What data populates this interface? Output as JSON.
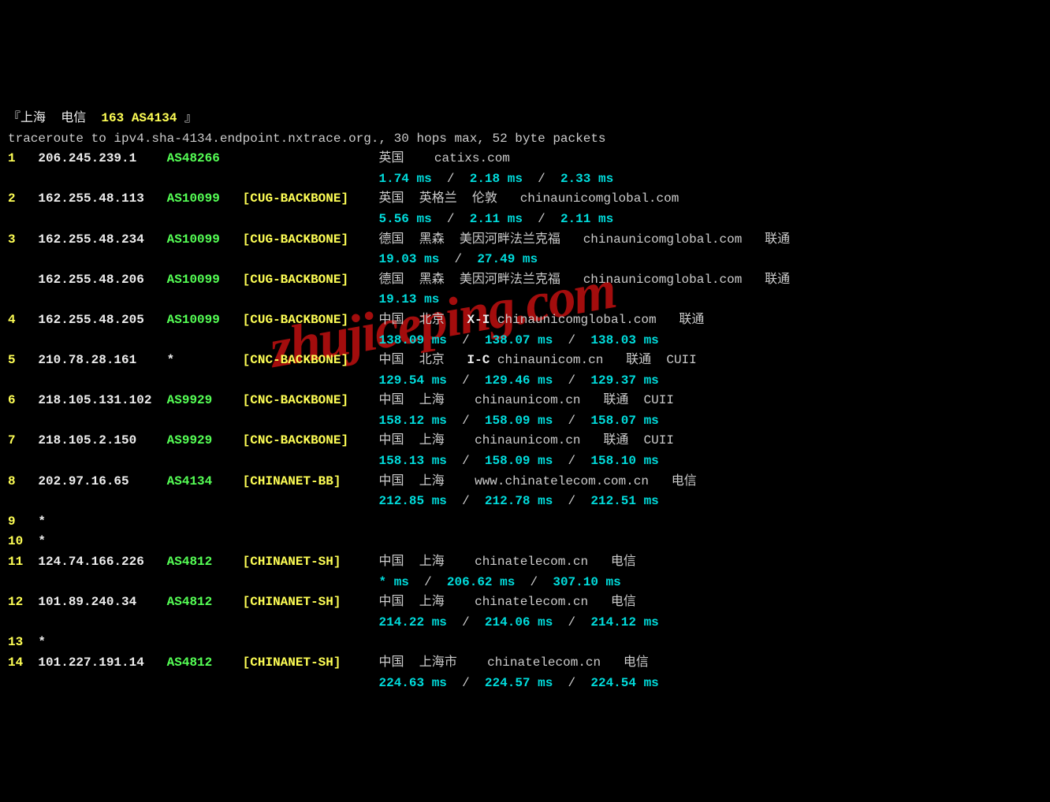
{
  "header": {
    "title": "『上海  电信  163 AS4134 』",
    "title_prefix": "『上海  电信  ",
    "title_yellow": "163 AS4134 ",
    "title_suffix": "』",
    "command": "traceroute to ipv4.sha-4134.endpoint.nxtrace.org., 30 hops max, 52 byte packets"
  },
  "watermark": "zhujiceping.com",
  "hops": [
    {
      "num": "1",
      "ip": "206.245.239.1",
      "asn": "AS48266",
      "tag": "",
      "loc": "英国    catixs.com",
      "lat": [
        "1.74 ms",
        "2.18 ms",
        "2.33 ms"
      ]
    },
    {
      "num": "2",
      "ip": "162.255.48.113",
      "asn": "AS10099",
      "tag": "[CUG-BACKBONE]",
      "loc": "英国  英格兰  伦敦   chinaunicomglobal.com",
      "lat": [
        "5.56 ms",
        "2.11 ms",
        "2.11 ms"
      ]
    },
    {
      "num": "3",
      "ip": "162.255.48.234",
      "asn": "AS10099",
      "tag": "[CUG-BACKBONE]",
      "loc": "德国  黑森  美因河畔法兰克福   chinaunicomglobal.com   联通",
      "lat": [
        "19.03 ms",
        "27.49 ms"
      ]
    },
    {
      "num": "",
      "ip": "162.255.48.206",
      "asn": "AS10099",
      "tag": "[CUG-BACKBONE]",
      "loc": "德国  黑森  美因河畔法兰克福   chinaunicomglobal.com   联通",
      "lat": [
        "19.13 ms"
      ]
    },
    {
      "num": "4",
      "ip": "162.255.48.205",
      "asn": "AS10099",
      "tag": "[CUG-BACKBONE]",
      "loc": "中国  北京   ",
      "loc_bold": "X-I",
      "loc2": " chinaunicomglobal.com   联通",
      "lat": [
        "138.09 ms",
        "138.07 ms",
        "138.03 ms"
      ]
    },
    {
      "num": "5",
      "ip": "210.78.28.161",
      "asn": "*",
      "asn_white": true,
      "tag": "[CNC-BACKBONE]",
      "loc": "中国  北京   ",
      "loc_bold": "I-C",
      "loc2": " chinaunicom.cn   联通  CUII",
      "lat": [
        "129.54 ms",
        "129.46 ms",
        "129.37 ms"
      ]
    },
    {
      "num": "6",
      "ip": "218.105.131.102",
      "asn": "AS9929",
      "tag": "[CNC-BACKBONE]",
      "loc": "中国  上海    chinaunicom.cn   联通  CUII",
      "lat": [
        "158.12 ms",
        "158.09 ms",
        "158.07 ms"
      ]
    },
    {
      "num": "7",
      "ip": "218.105.2.150",
      "asn": "AS9929",
      "tag": "[CNC-BACKBONE]",
      "loc": "中国  上海    chinaunicom.cn   联通  CUII",
      "lat": [
        "158.13 ms",
        "158.09 ms",
        "158.10 ms"
      ]
    },
    {
      "num": "8",
      "ip": "202.97.16.65",
      "asn": "AS4134",
      "tag": "[CHINANET-BB]",
      "loc": "中国  上海    www.chinatelecom.com.cn   电信",
      "lat": [
        "212.85 ms",
        "212.78 ms",
        "212.51 ms"
      ]
    },
    {
      "num": "9",
      "ip": "*",
      "star": true
    },
    {
      "num": "10",
      "ip": "*",
      "star": true
    },
    {
      "num": "11",
      "ip": "124.74.166.226",
      "asn": "AS4812",
      "tag": "[CHINANET-SH]",
      "loc": "中国  上海    chinatelecom.cn   电信",
      "lat": [
        "* ms",
        "206.62 ms",
        "307.10 ms"
      ]
    },
    {
      "num": "12",
      "ip": "101.89.240.34",
      "asn": "AS4812",
      "tag": "[CHINANET-SH]",
      "loc": "中国  上海    chinatelecom.cn   电信",
      "lat": [
        "214.22 ms",
        "214.06 ms",
        "214.12 ms"
      ]
    },
    {
      "num": "13",
      "ip": "*",
      "star": true
    },
    {
      "num": "14",
      "ip": "101.227.191.14",
      "asn": "AS4812",
      "tag": "[CHINANET-SH]",
      "loc": "中国  上海市    chinatelecom.cn   电信",
      "lat": [
        "224.63 ms",
        "224.57 ms",
        "224.54 ms"
      ]
    }
  ]
}
